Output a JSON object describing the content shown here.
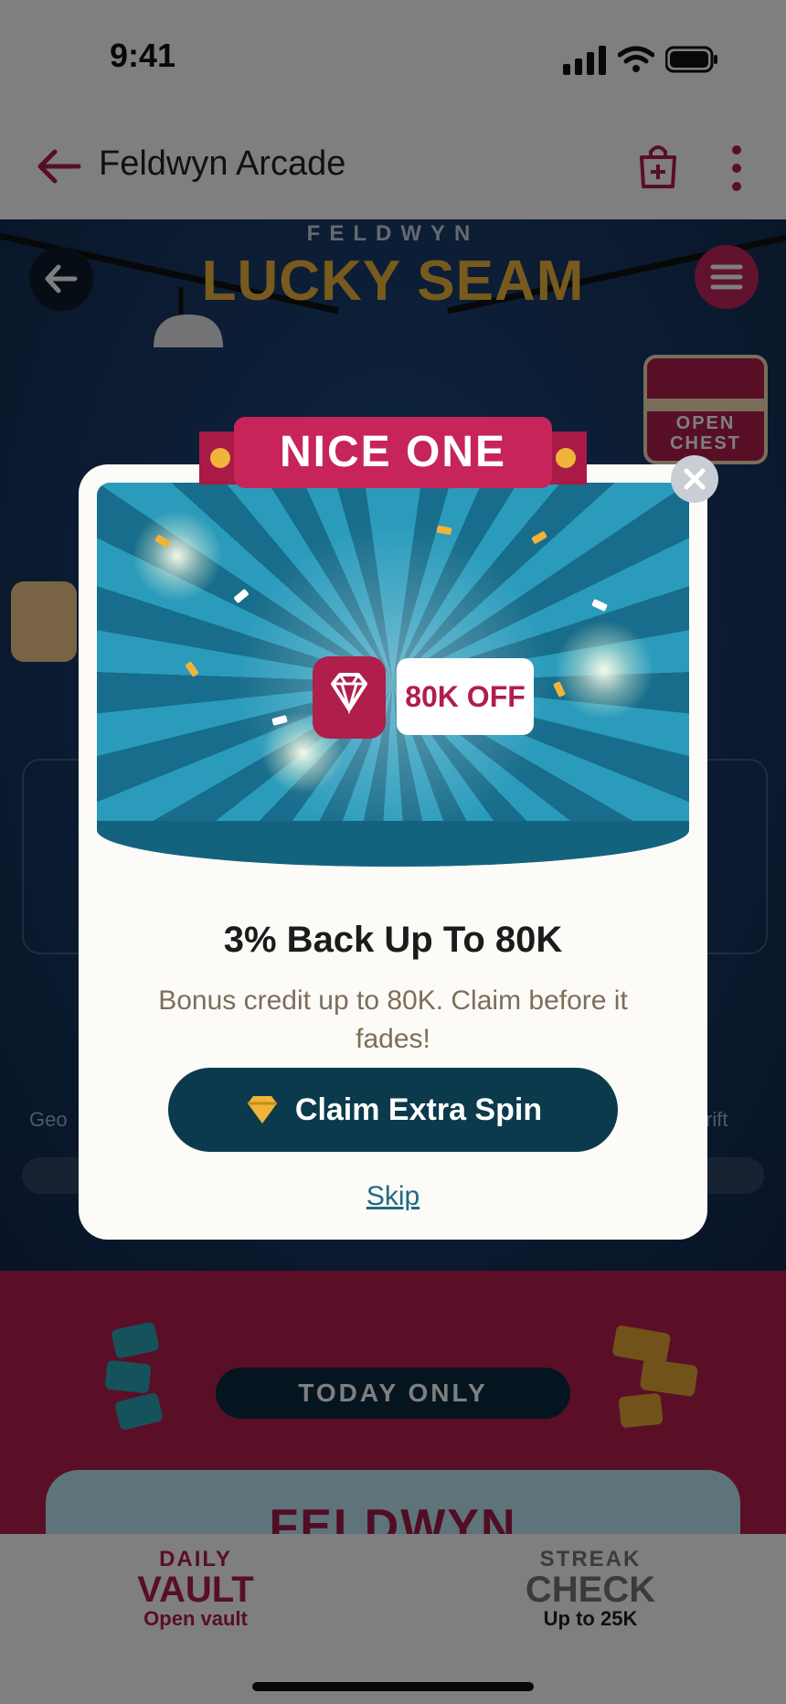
{
  "status_bar": {
    "time": "9:41"
  },
  "app_bar": {
    "title": "Feldwyn Arcade"
  },
  "game": {
    "subtitle": "FELDWYN",
    "title": "LUCKY SEAM",
    "open_chest_label": "OPEN CHEST",
    "left_card_label": "Geo",
    "right_card_label": "rift"
  },
  "promo": {
    "pill": "TODAY ONLY",
    "card_title": "FELDWYN"
  },
  "tabs": [
    {
      "small": "DAILY",
      "big": "VAULT",
      "caption": "Open vault"
    },
    {
      "small": "STREAK",
      "big": "CHECK",
      "caption": "Up to 25K"
    }
  ],
  "modal": {
    "ribbon": "NICE ONE",
    "reward_badge": "80K OFF",
    "title": "3% Back Up To 80K",
    "description": "Bonus credit up to 80K. Claim before it fades!",
    "cta": "Claim Extra Spin",
    "skip": "Skip"
  },
  "colors": {
    "accent": "#b01e4c",
    "cta": "#0b3a4d",
    "gold": "#f0b43a"
  },
  "icons": [
    "back-arrow-icon",
    "shopping-bag-icon",
    "more-vertical-icon",
    "menu-icon",
    "diamond-icon",
    "close-icon"
  ]
}
